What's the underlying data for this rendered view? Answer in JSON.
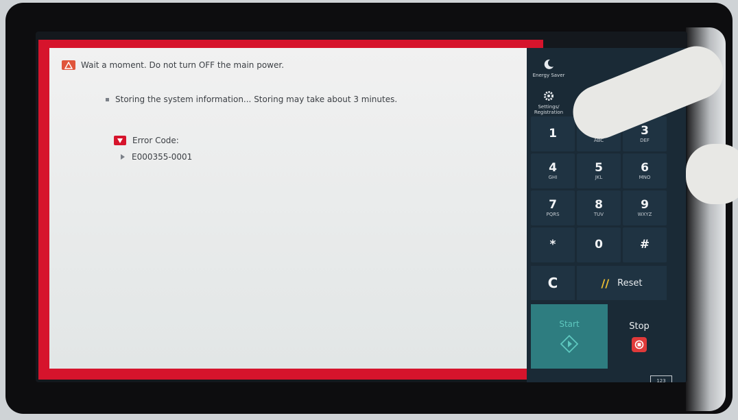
{
  "alert": {
    "warning_text": "Wait a moment. Do not turn OFF the main power.",
    "storing_text": "Storing the system information... Storing may take about 3 minutes.",
    "error_code_label": "Error Code:",
    "error_code_value": "E000355-0001",
    "accent_color": "#d6142c"
  },
  "side_buttons": {
    "energy_saver": "Energy Saver",
    "settings_registration": "Settings/\nRegistration"
  },
  "keypad": {
    "keys": [
      {
        "num": "1",
        "sub": ""
      },
      {
        "num": "2",
        "sub": "ABC"
      },
      {
        "num": "3",
        "sub": "DEF"
      },
      {
        "num": "4",
        "sub": "GHI"
      },
      {
        "num": "5",
        "sub": "JKL"
      },
      {
        "num": "6",
        "sub": "MNO"
      },
      {
        "num": "7",
        "sub": "PQRS"
      },
      {
        "num": "8",
        "sub": "TUV"
      },
      {
        "num": "9",
        "sub": "WXYZ"
      },
      {
        "num": "*",
        "sub": ""
      },
      {
        "num": "0",
        "sub": ""
      },
      {
        "num": "#",
        "sub": ""
      }
    ],
    "clear_label": "C",
    "reset_label": "Reset",
    "start_label": "Start",
    "stop_label": "Stop",
    "numeric_badge": "123"
  }
}
